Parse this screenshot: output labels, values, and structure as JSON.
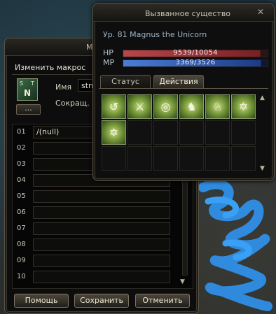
{
  "summon_window": {
    "title": "Вызванное существо",
    "close_glyph": "✕",
    "pet": "Ур. 81 Magnus the Unicorn",
    "hp_label": "HP",
    "hp_value": "9539/10054",
    "hp_fraction": 0.949,
    "mp_label": "MP",
    "mp_value": "3369/3526",
    "mp_fraction": 0.955,
    "tabs": [
      {
        "label": "Статус",
        "active": false
      },
      {
        "label": "Действия",
        "active": true
      }
    ],
    "skills": [
      {
        "icon": "summon-action-icon",
        "glyph": "↺"
      },
      {
        "icon": "claw-attack-icon",
        "glyph": "⚔"
      },
      {
        "icon": "target-icon",
        "glyph": "◎"
      },
      {
        "icon": "unicorn-head-icon",
        "glyph": "♞"
      },
      {
        "icon": "unicorn-buff-icon",
        "glyph": "♘"
      },
      {
        "icon": "hexagram-icon",
        "glyph": "✡"
      },
      {
        "icon": "hexagram-icon",
        "glyph": "✡"
      }
    ],
    "scroll_up": "▲",
    "scroll_down": "▼"
  },
  "macro_window": {
    "title_partial": "Ма",
    "section_title": "Изменить макрос",
    "icon_glyphs": [
      "S",
      "T",
      "N"
    ],
    "dots_button": "...",
    "name_label": "Имя",
    "name_value": "stn",
    "short_label": "Сокращ.",
    "lines": [
      {
        "num": "01",
        "text": "/(null)"
      },
      {
        "num": "02",
        "text": ""
      },
      {
        "num": "03",
        "text": ""
      },
      {
        "num": "04",
        "text": ""
      },
      {
        "num": "05",
        "text": ""
      },
      {
        "num": "06",
        "text": ""
      },
      {
        "num": "07",
        "text": ""
      },
      {
        "num": "08",
        "text": ""
      },
      {
        "num": "09",
        "text": ""
      },
      {
        "num": "10",
        "text": ""
      }
    ],
    "scroll_down": "▼",
    "buttons": {
      "help": "Помощь",
      "save": "Сохранить",
      "cancel": "Отменить"
    }
  },
  "colors": {
    "hp": "#b8474a",
    "mp": "#4b7dd6",
    "accent_text": "#9fb5c9",
    "scribble": "#2f8fe8"
  }
}
